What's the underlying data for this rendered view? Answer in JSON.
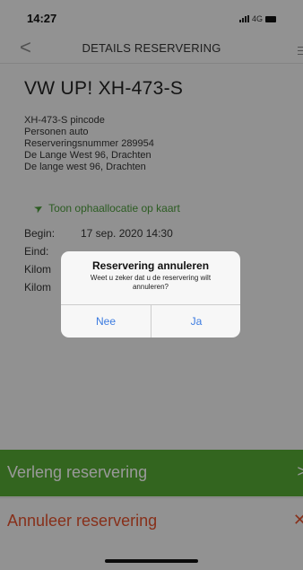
{
  "status_bar": {
    "time": "14:27",
    "network": "4G"
  },
  "header": {
    "title": "DETAILS RESERVERING"
  },
  "car": {
    "title": "VW UP! XH-473-S",
    "details": [
      "XH-473-S pincode",
      "Personen auto",
      "Reserveringsnummer 289954",
      "De Lange West 96, Drachten",
      "De lange west 96, Drachten"
    ],
    "map_link": "Toon ophaallocatie op kaart",
    "rows": [
      {
        "label": "Begin:",
        "value": "17 sep. 2020 14:30"
      },
      {
        "label": "Eind:",
        "value": ""
      },
      {
        "label": "Kilom",
        "value": ""
      },
      {
        "label": "Kilom",
        "value": ""
      }
    ]
  },
  "actions": {
    "extend_label": "Verleng reservering",
    "cancel_label": "Annuleer reservering"
  },
  "dialog": {
    "title": "Reservering annuleren",
    "message": "Weet u zeker dat u de reservering wilt annuleren?",
    "no_label": "Nee",
    "yes_label": "Ja"
  },
  "colors": {
    "accent_green": "#56a834",
    "cancel_red": "#e2502c",
    "dialog_button_blue": "#3b7be0"
  }
}
